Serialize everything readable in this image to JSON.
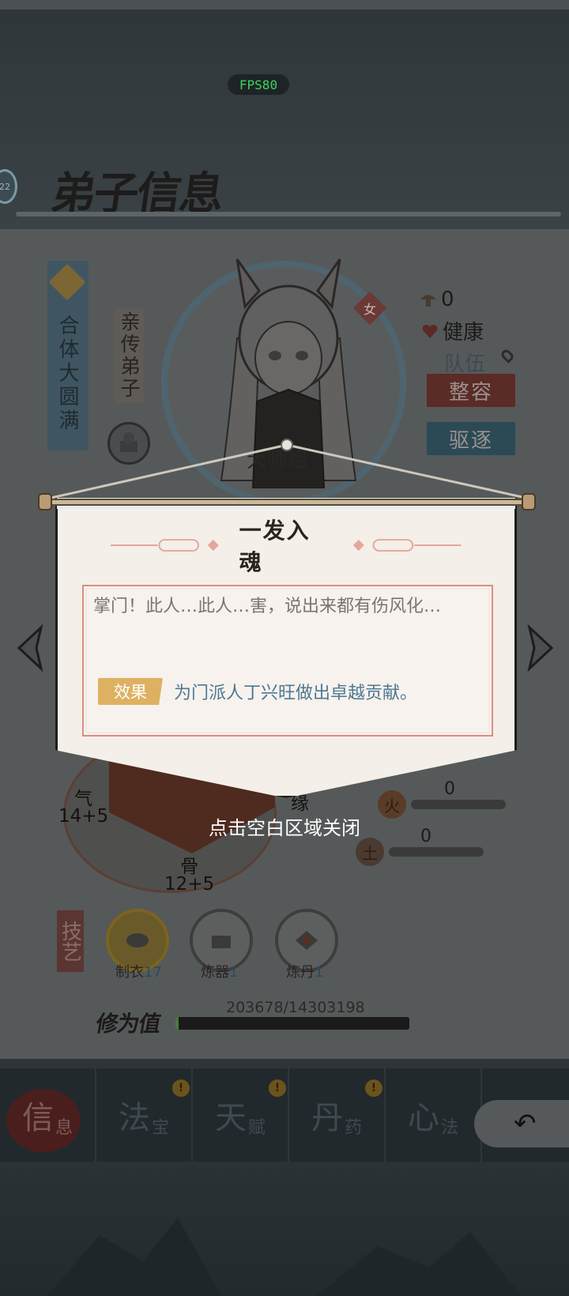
{
  "hud": {
    "fps": "FPS80",
    "side_badge": "22"
  },
  "header": {
    "title": "弟子信息"
  },
  "disciple": {
    "realm": "合体大圆满",
    "rank": "亲传弟子",
    "gender": "女",
    "nickname": "大师姐"
  },
  "status": {
    "count": "0",
    "health": "健康",
    "team": "队伍"
  },
  "actions": {
    "restyle_label": "整容",
    "expel_label": "驱逐"
  },
  "attributes": {
    "qi": {
      "label": "气",
      "value": "14+5"
    },
    "bone": {
      "label": "骨",
      "value": "12+5"
    },
    "fate": {
      "label": "缘"
    }
  },
  "elements": [
    {
      "name": "火",
      "value": "0",
      "progress": 0
    },
    {
      "name": "土",
      "value": "0",
      "progress": 0
    }
  ],
  "skills": {
    "tag": "技艺",
    "items": [
      {
        "name": "制衣",
        "level": "17",
        "active": true
      },
      {
        "name": "炼器",
        "level": "1",
        "active": false
      },
      {
        "name": "炼丹",
        "level": "1",
        "active": false
      }
    ]
  },
  "cultivation": {
    "label": "修为值",
    "text": "203678/14303198",
    "current": 203678,
    "max": 14303198
  },
  "nav": [
    {
      "big": "信",
      "small": "息",
      "active": true,
      "alert": false
    },
    {
      "big": "法",
      "small": "宝",
      "active": false,
      "alert": true
    },
    {
      "big": "天",
      "small": "赋",
      "active": false,
      "alert": true
    },
    {
      "big": "丹",
      "small": "药",
      "active": false,
      "alert": true
    },
    {
      "big": "心",
      "small": "法",
      "active": false,
      "alert": false
    }
  ],
  "popup": {
    "title": "一发入魂",
    "description": "掌门！此人…此人…害，说出来都有伤风化…",
    "effect_tag": "效果",
    "effect_text": "为门派人丁兴旺做出卓越贡献。",
    "close_hint": "点击空白区域关闭"
  },
  "colors": {
    "accent_gold": "#deb162",
    "effect_blue": "#4d7894",
    "box_border": "#d98f83"
  }
}
